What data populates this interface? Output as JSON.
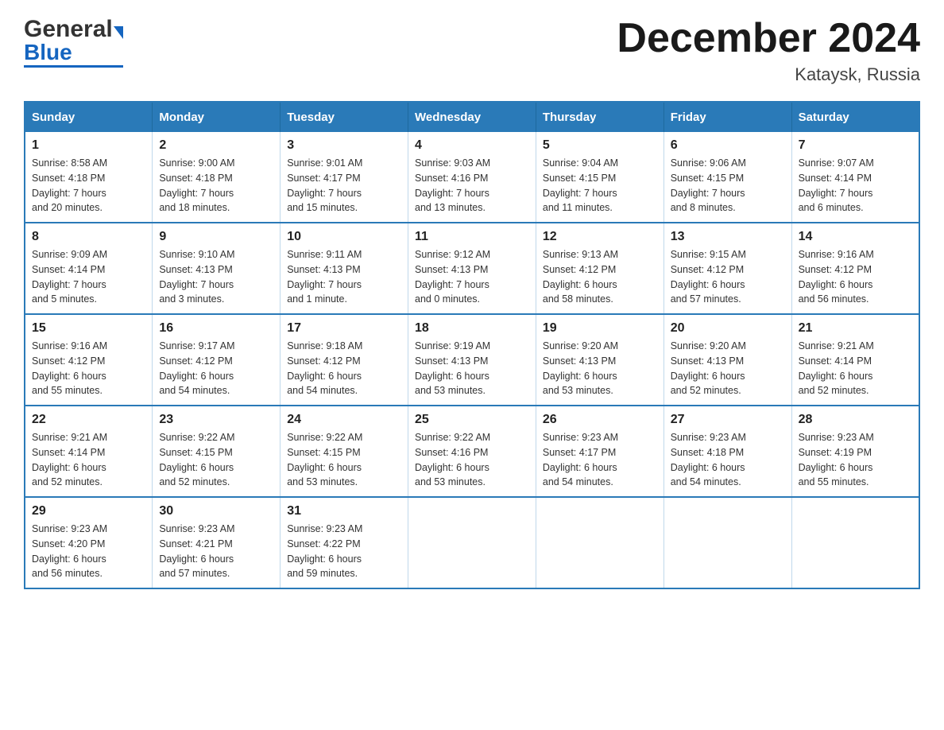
{
  "logo": {
    "general": "General",
    "arrow": "",
    "blue": "Blue"
  },
  "header": {
    "month_title": "December 2024",
    "location": "Kataysk, Russia"
  },
  "days_of_week": [
    "Sunday",
    "Monday",
    "Tuesday",
    "Wednesday",
    "Thursday",
    "Friday",
    "Saturday"
  ],
  "weeks": [
    [
      {
        "day": "1",
        "sunrise": "Sunrise: 8:58 AM",
        "sunset": "Sunset: 4:18 PM",
        "daylight": "Daylight: 7 hours",
        "minutes": "and 20 minutes."
      },
      {
        "day": "2",
        "sunrise": "Sunrise: 9:00 AM",
        "sunset": "Sunset: 4:18 PM",
        "daylight": "Daylight: 7 hours",
        "minutes": "and 18 minutes."
      },
      {
        "day": "3",
        "sunrise": "Sunrise: 9:01 AM",
        "sunset": "Sunset: 4:17 PM",
        "daylight": "Daylight: 7 hours",
        "minutes": "and 15 minutes."
      },
      {
        "day": "4",
        "sunrise": "Sunrise: 9:03 AM",
        "sunset": "Sunset: 4:16 PM",
        "daylight": "Daylight: 7 hours",
        "minutes": "and 13 minutes."
      },
      {
        "day": "5",
        "sunrise": "Sunrise: 9:04 AM",
        "sunset": "Sunset: 4:15 PM",
        "daylight": "Daylight: 7 hours",
        "minutes": "and 11 minutes."
      },
      {
        "day": "6",
        "sunrise": "Sunrise: 9:06 AM",
        "sunset": "Sunset: 4:15 PM",
        "daylight": "Daylight: 7 hours",
        "minutes": "and 8 minutes."
      },
      {
        "day": "7",
        "sunrise": "Sunrise: 9:07 AM",
        "sunset": "Sunset: 4:14 PM",
        "daylight": "Daylight: 7 hours",
        "minutes": "and 6 minutes."
      }
    ],
    [
      {
        "day": "8",
        "sunrise": "Sunrise: 9:09 AM",
        "sunset": "Sunset: 4:14 PM",
        "daylight": "Daylight: 7 hours",
        "minutes": "and 5 minutes."
      },
      {
        "day": "9",
        "sunrise": "Sunrise: 9:10 AM",
        "sunset": "Sunset: 4:13 PM",
        "daylight": "Daylight: 7 hours",
        "minutes": "and 3 minutes."
      },
      {
        "day": "10",
        "sunrise": "Sunrise: 9:11 AM",
        "sunset": "Sunset: 4:13 PM",
        "daylight": "Daylight: 7 hours",
        "minutes": "and 1 minute."
      },
      {
        "day": "11",
        "sunrise": "Sunrise: 9:12 AM",
        "sunset": "Sunset: 4:13 PM",
        "daylight": "Daylight: 7 hours",
        "minutes": "and 0 minutes."
      },
      {
        "day": "12",
        "sunrise": "Sunrise: 9:13 AM",
        "sunset": "Sunset: 4:12 PM",
        "daylight": "Daylight: 6 hours",
        "minutes": "and 58 minutes."
      },
      {
        "day": "13",
        "sunrise": "Sunrise: 9:15 AM",
        "sunset": "Sunset: 4:12 PM",
        "daylight": "Daylight: 6 hours",
        "minutes": "and 57 minutes."
      },
      {
        "day": "14",
        "sunrise": "Sunrise: 9:16 AM",
        "sunset": "Sunset: 4:12 PM",
        "daylight": "Daylight: 6 hours",
        "minutes": "and 56 minutes."
      }
    ],
    [
      {
        "day": "15",
        "sunrise": "Sunrise: 9:16 AM",
        "sunset": "Sunset: 4:12 PM",
        "daylight": "Daylight: 6 hours",
        "minutes": "and 55 minutes."
      },
      {
        "day": "16",
        "sunrise": "Sunrise: 9:17 AM",
        "sunset": "Sunset: 4:12 PM",
        "daylight": "Daylight: 6 hours",
        "minutes": "and 54 minutes."
      },
      {
        "day": "17",
        "sunrise": "Sunrise: 9:18 AM",
        "sunset": "Sunset: 4:12 PM",
        "daylight": "Daylight: 6 hours",
        "minutes": "and 54 minutes."
      },
      {
        "day": "18",
        "sunrise": "Sunrise: 9:19 AM",
        "sunset": "Sunset: 4:13 PM",
        "daylight": "Daylight: 6 hours",
        "minutes": "and 53 minutes."
      },
      {
        "day": "19",
        "sunrise": "Sunrise: 9:20 AM",
        "sunset": "Sunset: 4:13 PM",
        "daylight": "Daylight: 6 hours",
        "minutes": "and 53 minutes."
      },
      {
        "day": "20",
        "sunrise": "Sunrise: 9:20 AM",
        "sunset": "Sunset: 4:13 PM",
        "daylight": "Daylight: 6 hours",
        "minutes": "and 52 minutes."
      },
      {
        "day": "21",
        "sunrise": "Sunrise: 9:21 AM",
        "sunset": "Sunset: 4:14 PM",
        "daylight": "Daylight: 6 hours",
        "minutes": "and 52 minutes."
      }
    ],
    [
      {
        "day": "22",
        "sunrise": "Sunrise: 9:21 AM",
        "sunset": "Sunset: 4:14 PM",
        "daylight": "Daylight: 6 hours",
        "minutes": "and 52 minutes."
      },
      {
        "day": "23",
        "sunrise": "Sunrise: 9:22 AM",
        "sunset": "Sunset: 4:15 PM",
        "daylight": "Daylight: 6 hours",
        "minutes": "and 52 minutes."
      },
      {
        "day": "24",
        "sunrise": "Sunrise: 9:22 AM",
        "sunset": "Sunset: 4:15 PM",
        "daylight": "Daylight: 6 hours",
        "minutes": "and 53 minutes."
      },
      {
        "day": "25",
        "sunrise": "Sunrise: 9:22 AM",
        "sunset": "Sunset: 4:16 PM",
        "daylight": "Daylight: 6 hours",
        "minutes": "and 53 minutes."
      },
      {
        "day": "26",
        "sunrise": "Sunrise: 9:23 AM",
        "sunset": "Sunset: 4:17 PM",
        "daylight": "Daylight: 6 hours",
        "minutes": "and 54 minutes."
      },
      {
        "day": "27",
        "sunrise": "Sunrise: 9:23 AM",
        "sunset": "Sunset: 4:18 PM",
        "daylight": "Daylight: 6 hours",
        "minutes": "and 54 minutes."
      },
      {
        "day": "28",
        "sunrise": "Sunrise: 9:23 AM",
        "sunset": "Sunset: 4:19 PM",
        "daylight": "Daylight: 6 hours",
        "minutes": "and 55 minutes."
      }
    ],
    [
      {
        "day": "29",
        "sunrise": "Sunrise: 9:23 AM",
        "sunset": "Sunset: 4:20 PM",
        "daylight": "Daylight: 6 hours",
        "minutes": "and 56 minutes."
      },
      {
        "day": "30",
        "sunrise": "Sunrise: 9:23 AM",
        "sunset": "Sunset: 4:21 PM",
        "daylight": "Daylight: 6 hours",
        "minutes": "and 57 minutes."
      },
      {
        "day": "31",
        "sunrise": "Sunrise: 9:23 AM",
        "sunset": "Sunset: 4:22 PM",
        "daylight": "Daylight: 6 hours",
        "minutes": "and 59 minutes."
      },
      null,
      null,
      null,
      null
    ]
  ]
}
